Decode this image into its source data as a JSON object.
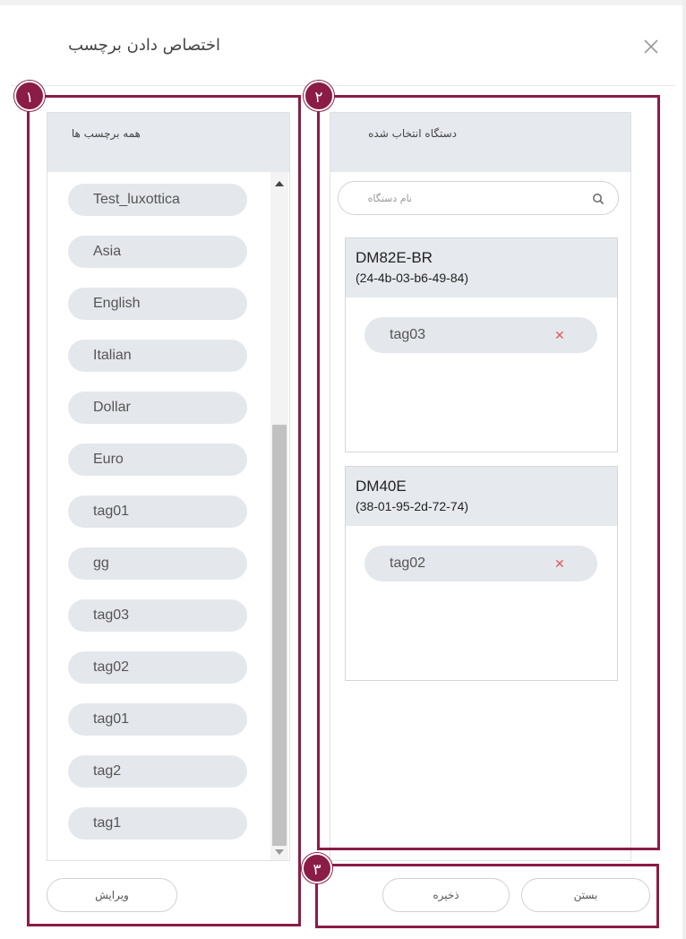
{
  "dialog": {
    "title": "اختصاص دادن برچسب"
  },
  "all_tags_panel": {
    "header": "همه برچسب ها",
    "tags": [
      "Test_luxottica",
      "Asia",
      "English",
      "Italian",
      "Dollar",
      "Euro",
      "tag01",
      "gg",
      "tag03",
      "tag02",
      "tag01",
      "tag2",
      "tag1"
    ]
  },
  "selected_devices_panel": {
    "header": "دستگاه انتخاب شده",
    "search_placeholder": "نام دستگاه",
    "devices": [
      {
        "name": "DM82E-BR",
        "mac": "(24-4b-03-b6-49-84)",
        "tags": [
          "tag03"
        ]
      },
      {
        "name": "DM40E",
        "mac": "(38-01-95-2d-72-74)",
        "tags": [
          "tag02"
        ]
      }
    ]
  },
  "buttons": {
    "edit": "ویرایش",
    "save": "ذخیره",
    "close": "بستن"
  },
  "annotations": {
    "badge_1": "١",
    "badge_2": "٢",
    "badge_3": "٣",
    "color": "#8a1c45"
  },
  "icons": [
    "close-icon",
    "search-icon",
    "scroll-up-arrow-icon",
    "scroll-down-arrow-icon",
    "remove-tag-icon"
  ]
}
